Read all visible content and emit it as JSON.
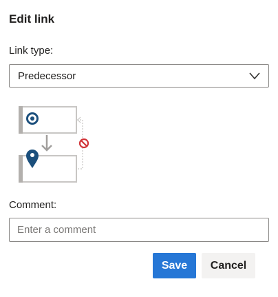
{
  "dialog": {
    "title": "Edit link",
    "link_type_label": "Link type:",
    "link_type_value": "Predecessor",
    "comment_label": "Comment:",
    "comment_placeholder": "Enter a comment",
    "comment_value": "",
    "save_label": "Save",
    "cancel_label": "Cancel"
  },
  "icons": {
    "select_chevron": "chevron-down-icon",
    "target": "target-icon",
    "location": "location-pin-icon",
    "blocked": "blocked-icon",
    "arrow": "arrow-down-icon"
  },
  "colors": {
    "primary": "#2677d6",
    "icon_navy": "#1b4f7c",
    "blocked_red": "#d13438",
    "connector_gray": "#a19f9d"
  }
}
